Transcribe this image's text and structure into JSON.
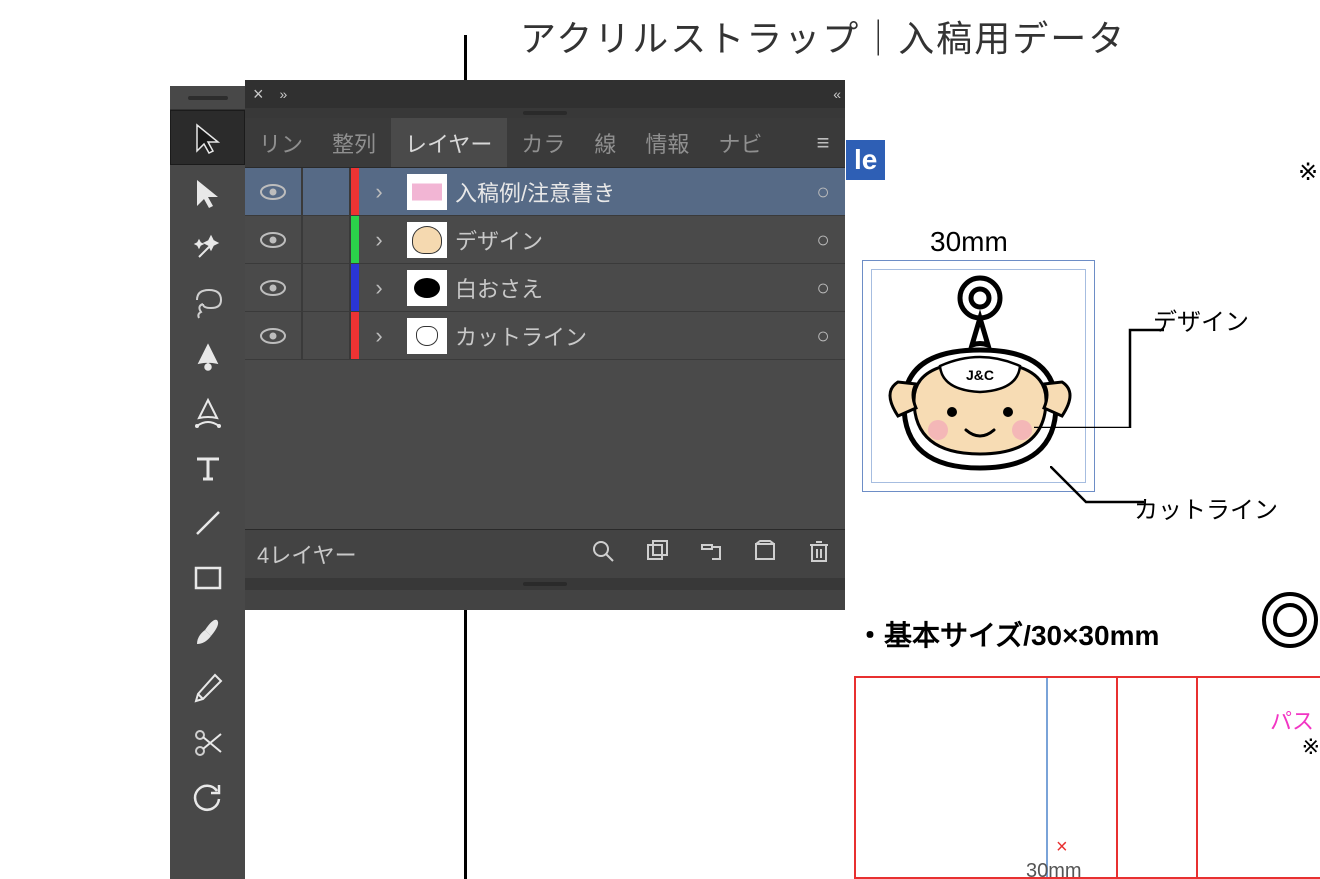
{
  "document": {
    "title": "アクリルストラップ｜入稿用データ",
    "le_fragment": "le",
    "asterisk": "※",
    "dim_top": "30mm",
    "label_design": "デザイン",
    "label_cutline": "カットライン",
    "section_size": "・基本サイズ/30×30mm",
    "path_label": "パス",
    "star_marker": "※",
    "red_x": "×",
    "dim_bottom": "30mm"
  },
  "tools": [
    {
      "id": "selection",
      "sel": true
    },
    {
      "id": "direct-selection"
    },
    {
      "id": "magic-wand"
    },
    {
      "id": "lasso"
    },
    {
      "id": "pen"
    },
    {
      "id": "curvature"
    },
    {
      "id": "type"
    },
    {
      "id": "line"
    },
    {
      "id": "rectangle"
    },
    {
      "id": "paintbrush"
    },
    {
      "id": "pencil"
    },
    {
      "id": "scissors"
    },
    {
      "id": "rotate"
    }
  ],
  "panel": {
    "close": "×",
    "expand": "»",
    "collapse": "«",
    "tabs": [
      {
        "label": "リン",
        "active": false
      },
      {
        "label": "整列",
        "active": false
      },
      {
        "label": "レイヤー",
        "active": true
      },
      {
        "label": "カラ",
        "active": false
      },
      {
        "label": "線",
        "active": false
      },
      {
        "label": "情報",
        "active": false
      },
      {
        "label": "ナビ",
        "active": false
      }
    ],
    "menu_glyph": "≡",
    "rows": [
      {
        "name": "入稿例/注意書き",
        "color": "#e33",
        "thumb": "pink",
        "selected": true
      },
      {
        "name": "デザイン",
        "color": "#2bd24a",
        "thumb": "char",
        "selected": false
      },
      {
        "name": "白おさえ",
        "color": "#2a35d6",
        "thumb": "black",
        "selected": false
      },
      {
        "name": "カットライン",
        "color": "#e33",
        "thumb": "cut",
        "selected": false
      }
    ],
    "expand_glyph": "›",
    "target_glyph": "○",
    "footer": {
      "count": "4レイヤー",
      "icons": [
        "search",
        "collect",
        "locate",
        "new-sublayer",
        "trash"
      ]
    }
  }
}
